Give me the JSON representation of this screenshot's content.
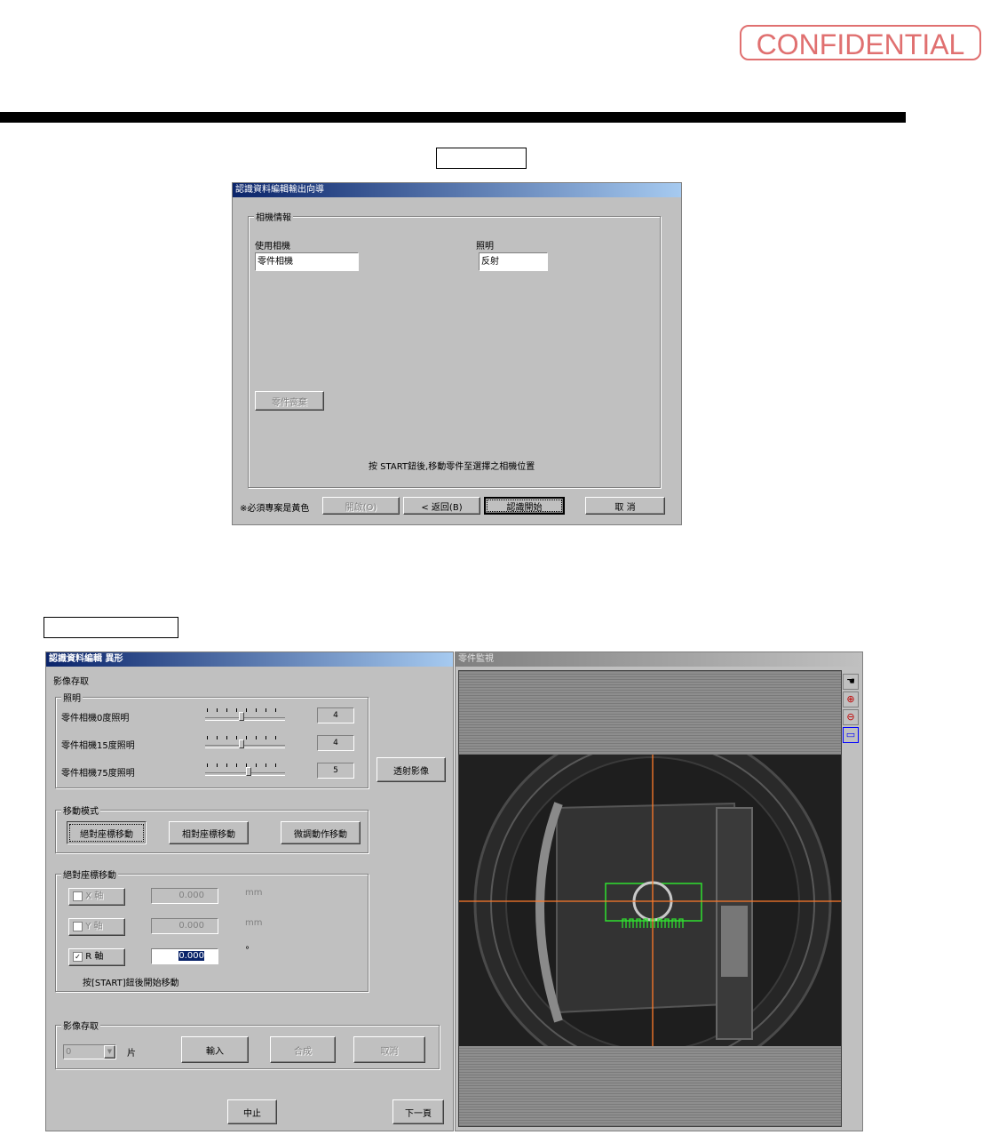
{
  "header": {
    "confidential": "CONFIDENTIAL"
  },
  "dialog1": {
    "title": "認識資料編輯輸出向導",
    "group_title": "相機情報",
    "camera_label": "使用相機",
    "camera_value": "零件相機",
    "light_label": "照明",
    "light_value": "反射",
    "part_btn": "零件喪棄",
    "instruction": "按 START鈕後,移動零件至選擇之相機位置",
    "note": "※必須專案是黃色",
    "open_btn": "開啟(O)",
    "back_btn": "< 返回(B)",
    "start_btn": "認識開始",
    "cancel_btn": "取 消"
  },
  "dialog2": {
    "title": "認識資料編輯 異形",
    "section_label": "影像存取",
    "light_group": "照明",
    "lights": [
      {
        "label": "零件相機0度照明",
        "value": "4",
        "level": 0.45
      },
      {
        "label": "零件相機15度照明",
        "value": "4",
        "level": 0.45
      },
      {
        "label": "零件相機75度照明",
        "value": "5",
        "level": 0.55
      }
    ],
    "transmit_btn": "透射影像",
    "move_mode_group": "移動模式",
    "move_buttons": [
      "絕對座標移動",
      "相對座標移動",
      "微調動作移動"
    ],
    "abs_move_group": "絕對座標移動",
    "axes": [
      {
        "label": "X 軸",
        "value": "0.000",
        "unit": "mm",
        "checked": false,
        "enabled": false
      },
      {
        "label": "Y 軸",
        "value": "0.000",
        "unit": "mm",
        "checked": false,
        "enabled": false
      },
      {
        "label": "R 軸",
        "value": "0.000",
        "unit": "°",
        "checked": true,
        "enabled": true
      }
    ],
    "move_hint": "按[START]鈕後開始移動",
    "capture_group": "影像存取",
    "capture_count": "0",
    "capture_unit": "片",
    "input_btn": "輸入",
    "merge_btn": "合成",
    "cancel_btn": "取消",
    "stop_btn": "中止",
    "next_btn": "下一頁"
  },
  "monitor": {
    "title": "零件監視",
    "tools": [
      "hand-icon",
      "zoom-in-icon",
      "zoom-out-icon",
      "fit-window-icon"
    ]
  }
}
